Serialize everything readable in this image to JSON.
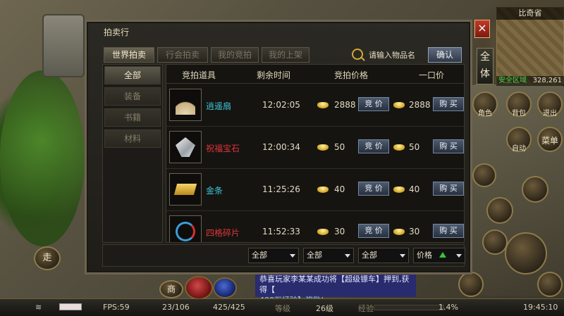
{
  "map": {
    "name": "比奇省",
    "safe_zone": "安全区域",
    "coords": "328,261"
  },
  "side_buttons": {
    "all": "全体",
    "role": "角色",
    "bag": "背包",
    "exit": "退出",
    "auto": "自动",
    "menu": "菜单",
    "walk": "走",
    "shop": "商"
  },
  "auction": {
    "title": "拍卖行",
    "close": "×",
    "tabs": [
      {
        "label": "世界拍卖",
        "active": true
      },
      {
        "label": "行会拍卖",
        "active": false
      },
      {
        "label": "我的竞拍",
        "active": false
      },
      {
        "label": "我的上架",
        "active": false
      }
    ],
    "search": {
      "placeholder": "请输入物品名",
      "confirm": "确认"
    },
    "categories": [
      {
        "label": "全部",
        "active": true
      },
      {
        "label": "装备",
        "active": false
      },
      {
        "label": "书籍",
        "active": false
      },
      {
        "label": "材料",
        "active": false
      }
    ],
    "columns": {
      "item": "竞拍道具",
      "time": "剩余时间",
      "price": "竞拍价格",
      "buyout": "一口价"
    },
    "rows": [
      {
        "name": "逍遥扇",
        "name_color": "#3fc6d8",
        "time": "12:02:05",
        "price": "2888",
        "bid": "竞 价",
        "buyout": "2888",
        "buy": "购 买",
        "icon": "fan-icon"
      },
      {
        "name": "祝福宝石",
        "name_color": "#e0343a",
        "time": "12:00:34",
        "price": "50",
        "bid": "竞 价",
        "buyout": "50",
        "buy": "购 买",
        "icon": "gem-icon"
      },
      {
        "name": "金条",
        "name_color": "#3fc6d8",
        "time": "11:25:26",
        "price": "40",
        "bid": "竞 价",
        "buyout": "40",
        "buy": "购 买",
        "icon": "gold-bar-icon"
      },
      {
        "name": "四格碎片",
        "name_color": "#e0343a",
        "time": "11:52:33",
        "price": "30",
        "bid": "竞 价",
        "buyout": "30",
        "buy": "购 买",
        "icon": "fragment-icon"
      }
    ],
    "filters": [
      "全部",
      "全部",
      "全部",
      "价格"
    ]
  },
  "notice": {
    "line1": "恭喜玩家李某某成功将【超级镖车】押到,获得【",
    "line2": "400万经验】奖励!"
  },
  "status": {
    "fps": "FPS:59",
    "bag": "23/106",
    "hp": "425/425",
    "level_label": "等级",
    "level": "26级",
    "exp_label": "经验",
    "exp": "1.4%",
    "time": "19:45:10"
  }
}
